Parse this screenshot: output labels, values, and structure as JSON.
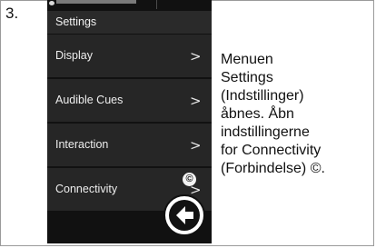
{
  "step": {
    "number": "3."
  },
  "screen": {
    "title": "Settings",
    "menu_items": [
      {
        "label": "Display",
        "icon": "chevron-right-icon"
      },
      {
        "label": "Audible Cues",
        "icon": "chevron-right-icon"
      },
      {
        "label": "Interaction",
        "icon": "chevron-right-icon"
      },
      {
        "label": "Connectivity",
        "icon": "chevron-right-icon"
      }
    ],
    "callout_marker": "©",
    "back_button_icon": "arrow-left-icon"
  },
  "description": {
    "text": "Menuen\nSettings\n(Indstillinger)\nåbnes. Åbn\nindstillingerne\nfor Connectivity\n(Forbindelse) ©."
  }
}
